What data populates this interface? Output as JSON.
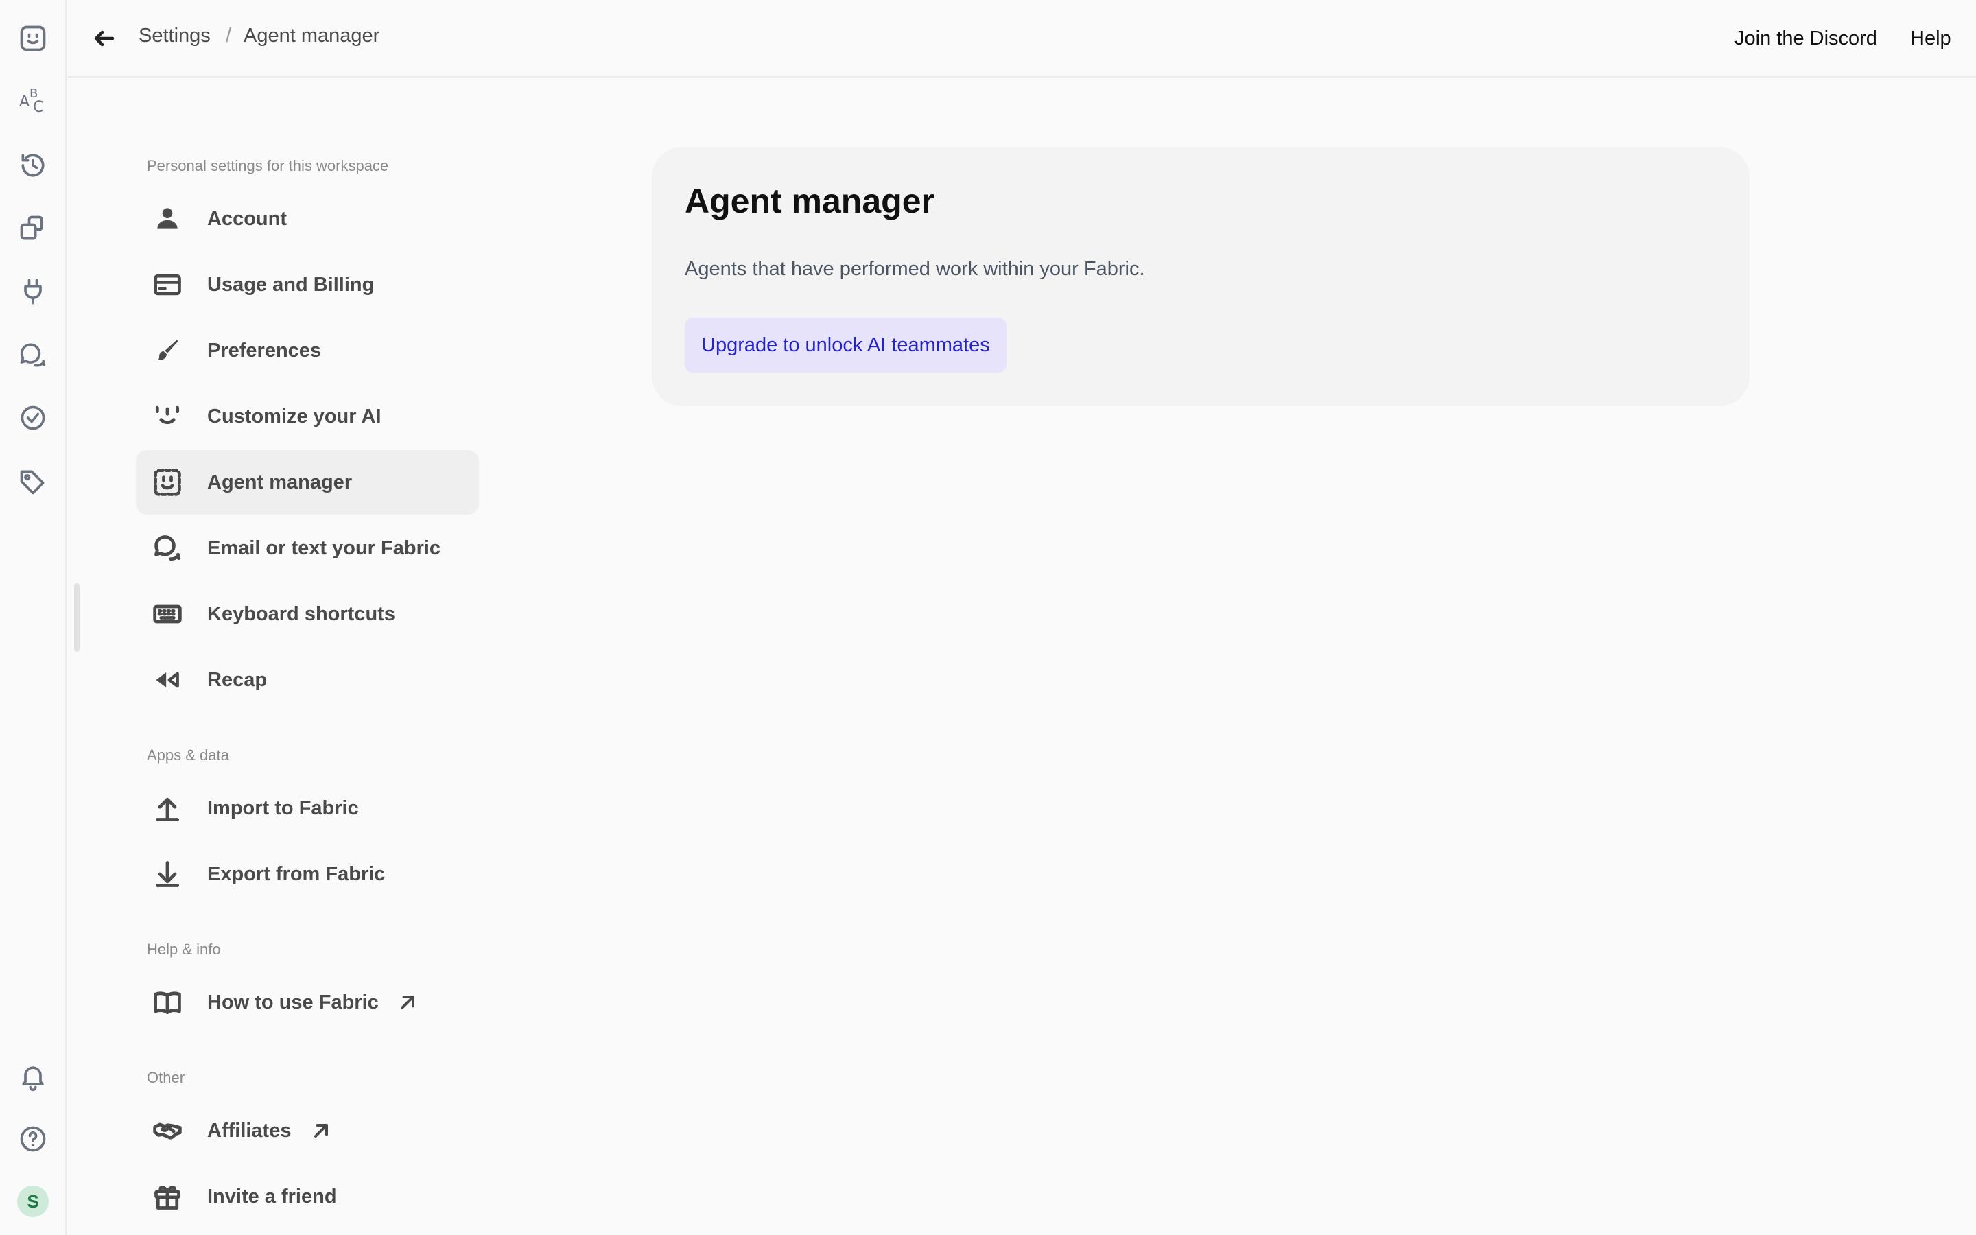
{
  "rail": {
    "icons": [
      "fabric-logo-icon",
      "abc-icon",
      "history-icon",
      "copy-icon",
      "plug-icon",
      "chat-icon",
      "check-circle-icon",
      "tag-icon",
      "bell-icon",
      "help-icon"
    ],
    "abc_glyphs": {
      "a": "A",
      "b": "B",
      "c": "C"
    },
    "avatar_initial": "S"
  },
  "topbar": {
    "breadcrumb": {
      "root": "Settings",
      "separator": "/",
      "current": "Agent manager"
    },
    "discord_label": "Join the Discord",
    "help_label": "Help"
  },
  "nav": {
    "sections": [
      {
        "label": "Personal settings for this workspace",
        "items": [
          {
            "label": "Account",
            "icon": "person-icon"
          },
          {
            "label": "Usage and Billing",
            "icon": "credit-card-icon"
          },
          {
            "label": "Preferences",
            "icon": "brush-icon"
          },
          {
            "label": "Customize your AI",
            "icon": "smile-icon"
          },
          {
            "label": "Agent manager",
            "icon": "agent-face-icon",
            "active": true
          },
          {
            "label": "Email or text your Fabric",
            "icon": "chat-bubbles-icon"
          },
          {
            "label": "Keyboard shortcuts",
            "icon": "keyboard-icon"
          },
          {
            "label": "Recap",
            "icon": "rewind-icon"
          }
        ]
      },
      {
        "label": "Apps & data",
        "items": [
          {
            "label": "Import to Fabric",
            "icon": "upload-icon"
          },
          {
            "label": "Export from Fabric",
            "icon": "download-icon"
          }
        ]
      },
      {
        "label": "Help & info",
        "items": [
          {
            "label": "How to use Fabric",
            "icon": "book-icon",
            "external": true
          }
        ]
      },
      {
        "label": "Other",
        "items": [
          {
            "label": "Affiliates",
            "icon": "handshake-icon",
            "external": true
          },
          {
            "label": "Invite a friend",
            "icon": "gift-icon"
          }
        ]
      }
    ]
  },
  "main": {
    "title": "Agent manager",
    "description": "Agents that have performed work within your Fabric.",
    "upgrade_label": "Upgrade to unlock AI teammates"
  },
  "colors": {
    "background": "#fafafa",
    "active_nav": "#efefef",
    "card": "#f3f3f3",
    "upgrade_bg": "#e6e3fb",
    "upgrade_text": "#2323c8",
    "avatar_bg": "#cdebd8",
    "avatar_text": "#1f7a45"
  }
}
